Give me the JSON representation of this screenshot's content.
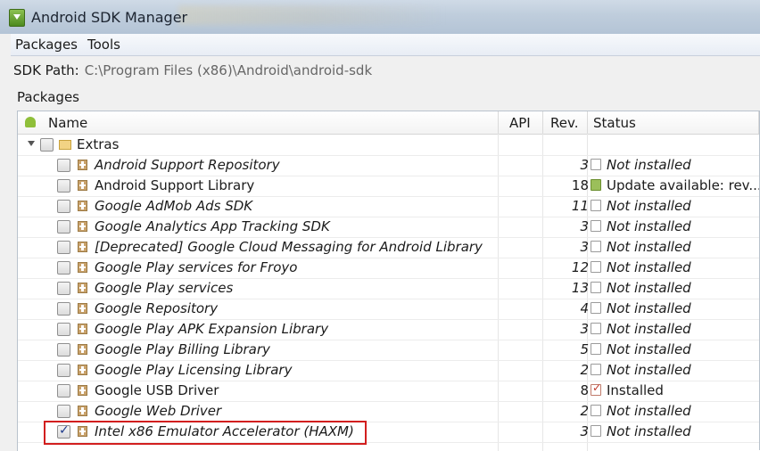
{
  "window": {
    "title": "Android SDK Manager"
  },
  "menu": {
    "items": [
      {
        "label": "Packages"
      },
      {
        "label": "Tools"
      }
    ]
  },
  "sdk_path": {
    "label": "SDK Path:",
    "value": "C:\\Program Files (x86)\\Android\\android-sdk"
  },
  "packages_label": "Packages",
  "table": {
    "columns": {
      "name": "Name",
      "api": "API",
      "rev": "Rev.",
      "status": "Status"
    },
    "group": {
      "label": "Extras",
      "expanded": true,
      "checked": false
    },
    "rows": [
      {
        "name": "Android Support Repository",
        "api": "",
        "rev": "3",
        "status": "Not installed",
        "state": "not_installed",
        "checked": false
      },
      {
        "name": "Android Support Library",
        "api": "",
        "rev": "18",
        "status": "Update available: rev...",
        "state": "update",
        "checked": false
      },
      {
        "name": "Google AdMob Ads SDK",
        "api": "",
        "rev": "11",
        "status": "Not installed",
        "state": "not_installed",
        "checked": false
      },
      {
        "name": "Google Analytics App Tracking SDK",
        "api": "",
        "rev": "3",
        "status": "Not installed",
        "state": "not_installed",
        "checked": false
      },
      {
        "name": "[Deprecated] Google Cloud Messaging for Android Library",
        "api": "",
        "rev": "3",
        "status": "Not installed",
        "state": "not_installed",
        "checked": false
      },
      {
        "name": "Google Play services for Froyo",
        "api": "",
        "rev": "12",
        "status": "Not installed",
        "state": "not_installed",
        "checked": false
      },
      {
        "name": "Google Play services",
        "api": "",
        "rev": "13",
        "status": "Not installed",
        "state": "not_installed",
        "checked": false
      },
      {
        "name": "Google Repository",
        "api": "",
        "rev": "4",
        "status": "Not installed",
        "state": "not_installed",
        "checked": false
      },
      {
        "name": "Google Play APK Expansion Library",
        "api": "",
        "rev": "3",
        "status": "Not installed",
        "state": "not_installed",
        "checked": false
      },
      {
        "name": "Google Play Billing Library",
        "api": "",
        "rev": "5",
        "status": "Not installed",
        "state": "not_installed",
        "checked": false
      },
      {
        "name": "Google Play Licensing Library",
        "api": "",
        "rev": "2",
        "status": "Not installed",
        "state": "not_installed",
        "checked": false
      },
      {
        "name": "Google USB Driver",
        "api": "",
        "rev": "8",
        "status": "Installed",
        "state": "installed",
        "checked": false
      },
      {
        "name": "Google Web Driver",
        "api": "",
        "rev": "2",
        "status": "Not installed",
        "state": "not_installed",
        "checked": false
      },
      {
        "name": "Intel x86 Emulator Accelerator (HAXM)",
        "api": "",
        "rev": "3",
        "status": "Not installed",
        "state": "not_installed",
        "checked": true
      }
    ]
  },
  "colors": {
    "highlight": "#d21e1e",
    "titlebar": "#bfcddc"
  },
  "icons": {
    "app": "android-sdk-download-icon",
    "name_header": "android-icon",
    "group": "folder-icon",
    "package": "package-icon",
    "status_not_installed": "empty-box-icon",
    "status_update": "update-package-icon",
    "status_installed": "installed-check-icon"
  }
}
